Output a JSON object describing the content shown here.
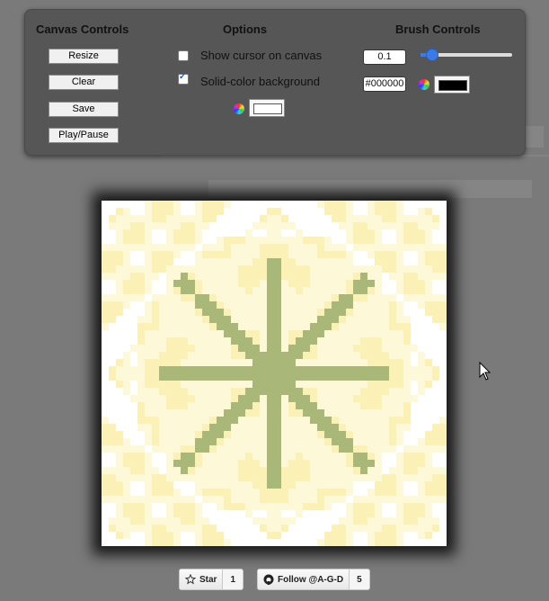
{
  "panel": {
    "canvas_controls": {
      "title": "Canvas Controls",
      "buttons": [
        "Resize",
        "Clear",
        "Save",
        "Play/Pause"
      ]
    },
    "options": {
      "title": "Options",
      "show_cursor_label": "Show cursor on canvas",
      "show_cursor_checked": false,
      "solid_bg_label": "Solid-color background",
      "solid_bg_checked": true,
      "bg_color": "#ffffff"
    },
    "brush_controls": {
      "title": "Brush Controls",
      "size_value": "0.1",
      "slider_value": 0.1,
      "color_value": "#000000",
      "brush_color": "#000000"
    }
  },
  "footer": {
    "star_label": "Star",
    "star_count": "1",
    "follow_label": "Follow @A-G-D",
    "follow_count": "5"
  },
  "colors": {
    "pattern_green": "#a9b878",
    "pattern_light": "#fbf1b6",
    "pattern_white": "#ffffff",
    "accent": "#3b7be8"
  }
}
